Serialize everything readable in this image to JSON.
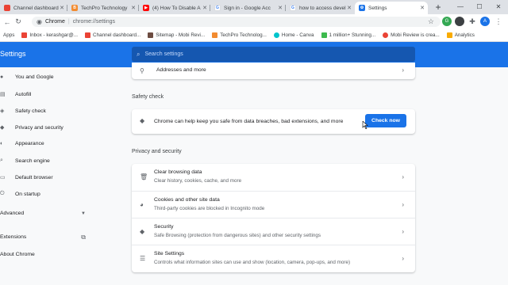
{
  "tabs": [
    {
      "title": "Channel dashboard",
      "color": "#ea4335"
    },
    {
      "title": "TechPro Technology",
      "color": "#f28b30"
    },
    {
      "title": "(4) How To Disable A",
      "color": "#ff0000"
    },
    {
      "title": "Sign in - Google Acc",
      "color": "#4285f4"
    },
    {
      "title": "how to access devel",
      "color": "#4285f4"
    },
    {
      "title": "Settings",
      "color": "#1a73e8"
    }
  ],
  "toolbar": {
    "site_label": "Chrome",
    "url": "chrome://settings",
    "avatar_letter": "A",
    "profile_g": "G"
  },
  "bookmarks": [
    {
      "label": "Apps",
      "color": "#5f6368"
    },
    {
      "label": "Inbox - kerashgar@...",
      "color": "#ea4335"
    },
    {
      "label": "Channel dashboard...",
      "color": "#ea4335"
    },
    {
      "label": "Sitemap - Mobi Revi...",
      "color": "#6d4c41"
    },
    {
      "label": "TechPro Technolog...",
      "color": "#f28b30"
    },
    {
      "label": "Home - Canva",
      "color": "#00c4cc"
    },
    {
      "label": "1 million+ Stunning...",
      "color": "#3dba4e"
    },
    {
      "label": "Mobi Review is crea...",
      "color": "#ea4335"
    },
    {
      "label": "Analytics",
      "color": "#f9ab00"
    }
  ],
  "header": {
    "title": "Settings",
    "search_placeholder": "Search settings"
  },
  "sidebar": [
    {
      "label": "You and Google",
      "icon": "person-icon"
    },
    {
      "label": "Autofill",
      "icon": "autofill-icon"
    },
    {
      "label": "Safety check",
      "icon": "shield-check-icon"
    },
    {
      "label": "Privacy and security",
      "icon": "shield-icon"
    },
    {
      "label": "Appearance",
      "icon": "palette-icon"
    },
    {
      "label": "Search engine",
      "icon": "search-icon"
    },
    {
      "label": "Default browser",
      "icon": "browser-icon"
    },
    {
      "label": "On startup",
      "icon": "power-icon"
    },
    {
      "label": "Advanced",
      "icon": "chevron-down-icon"
    },
    {
      "label": "Extensions",
      "icon": "open-external-icon"
    },
    {
      "label": "About Chrome",
      "icon": ""
    }
  ],
  "addresses": {
    "label": "Addresses and more"
  },
  "safety": {
    "section": "Safety check",
    "text": "Chrome can help keep you safe from data breaches, bad extensions, and more",
    "button": "Check now"
  },
  "privacy": {
    "section": "Privacy and security",
    "rows": [
      {
        "title": "Clear browsing data",
        "sub": "Clear history, cookies, cache, and more",
        "icon": "trash-icon"
      },
      {
        "title": "Cookies and other site data",
        "sub": "Third-party cookies are blocked in Incognito mode",
        "icon": "cookie-icon"
      },
      {
        "title": "Security",
        "sub": "Safe Browsing (protection from dangerous sites) and other security settings",
        "icon": "shield-icon"
      },
      {
        "title": "Site Settings",
        "sub": "Controls what information sites can use and show (location, camera, pop-ups, and more)",
        "icon": "sliders-icon"
      }
    ]
  }
}
